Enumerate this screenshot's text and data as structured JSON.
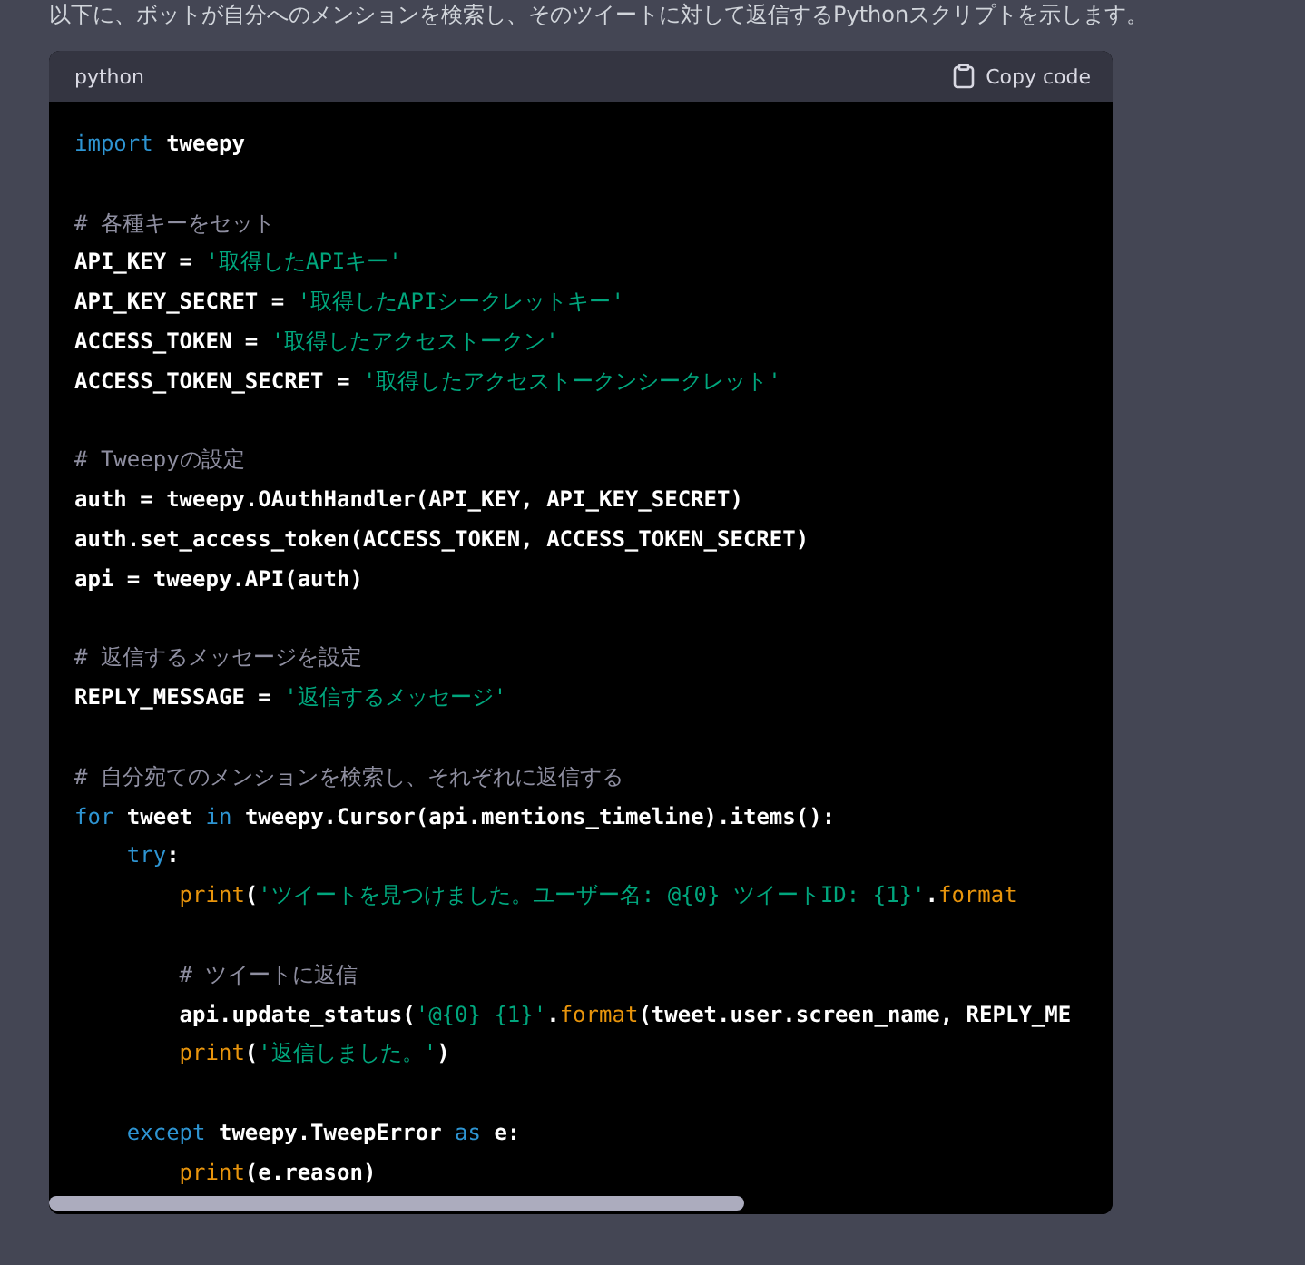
{
  "intro_text": "以下に、ボットが自分へのメンションを検索し、そのツイートに対して返信するPythonスクリプトを示します。",
  "code_block": {
    "language": "python",
    "copy_button": "Copy code",
    "paragraphs": [
      [
        [
          {
            "kind": "keyword",
            "text": "import"
          },
          {
            "kind": "plain",
            "text": " tweepy"
          }
        ]
      ],
      [
        [
          {
            "kind": "comment",
            "text": "# 各種キーをセット"
          }
        ],
        [
          {
            "kind": "plain",
            "text": "API_KEY = "
          },
          {
            "kind": "string",
            "text": "'取得したAPIキー'"
          }
        ],
        [
          {
            "kind": "plain",
            "text": "API_KEY_SECRET = "
          },
          {
            "kind": "string",
            "text": "'取得したAPIシークレットキー'"
          }
        ],
        [
          {
            "kind": "plain",
            "text": "ACCESS_TOKEN = "
          },
          {
            "kind": "string",
            "text": "'取得したアクセストークン'"
          }
        ],
        [
          {
            "kind": "plain",
            "text": "ACCESS_TOKEN_SECRET = "
          },
          {
            "kind": "string",
            "text": "'取得したアクセストークンシークレット'"
          }
        ]
      ],
      [
        [
          {
            "kind": "comment",
            "text": "# Tweepyの設定"
          }
        ],
        [
          {
            "kind": "plain",
            "text": "auth = tweepy.OAuthHandler(API_KEY, API_KEY_SECRET)"
          }
        ],
        [
          {
            "kind": "plain",
            "text": "auth.set_access_token(ACCESS_TOKEN, ACCESS_TOKEN_SECRET)"
          }
        ],
        [
          {
            "kind": "plain",
            "text": "api = tweepy.API(auth)"
          }
        ]
      ],
      [
        [
          {
            "kind": "comment",
            "text": "# 返信するメッセージを設定"
          }
        ],
        [
          {
            "kind": "plain",
            "text": "REPLY_MESSAGE = "
          },
          {
            "kind": "string",
            "text": "'返信するメッセージ'"
          }
        ]
      ],
      [
        [
          {
            "kind": "comment",
            "text": "# 自分宛てのメンションを検索し、それぞれに返信する"
          }
        ],
        [
          {
            "kind": "keyword",
            "text": "for"
          },
          {
            "kind": "plain",
            "text": " tweet "
          },
          {
            "kind": "keyword",
            "text": "in"
          },
          {
            "kind": "plain",
            "text": " tweepy.Cursor(api.mentions_timeline).items():"
          }
        ],
        [
          {
            "kind": "keyword",
            "text": "    try"
          },
          {
            "kind": "plain",
            "text": ":"
          }
        ],
        [
          {
            "kind": "function",
            "text": "        print"
          },
          {
            "kind": "plain",
            "text": "("
          },
          {
            "kind": "string",
            "text": "'ツイートを見つけました。ユーザー名: @{0} ツイートID: {1}'"
          },
          {
            "kind": "plain",
            "text": "."
          },
          {
            "kind": "function",
            "text": "format"
          }
        ]
      ],
      [
        [
          {
            "kind": "comment",
            "text": "        # ツイートに返信"
          }
        ],
        [
          {
            "kind": "plain",
            "text": "        api.update_status("
          },
          {
            "kind": "string",
            "text": "'@{0} {1}'"
          },
          {
            "kind": "plain",
            "text": "."
          },
          {
            "kind": "function",
            "text": "format"
          },
          {
            "kind": "plain",
            "text": "(tweet.user.screen_name, REPLY_ME"
          }
        ],
        [
          {
            "kind": "function",
            "text": "        print"
          },
          {
            "kind": "plain",
            "text": "("
          },
          {
            "kind": "string",
            "text": "'返信しました。'"
          },
          {
            "kind": "plain",
            "text": ")"
          }
        ]
      ],
      [
        [
          {
            "kind": "keyword",
            "text": "    except"
          },
          {
            "kind": "plain",
            "text": " tweepy.TweepError "
          },
          {
            "kind": "keyword",
            "text": "as"
          },
          {
            "kind": "plain",
            "text": " e:"
          }
        ],
        [
          {
            "kind": "function",
            "text": "        print"
          },
          {
            "kind": "plain",
            "text": "(e.reason)"
          }
        ]
      ]
    ]
  }
}
